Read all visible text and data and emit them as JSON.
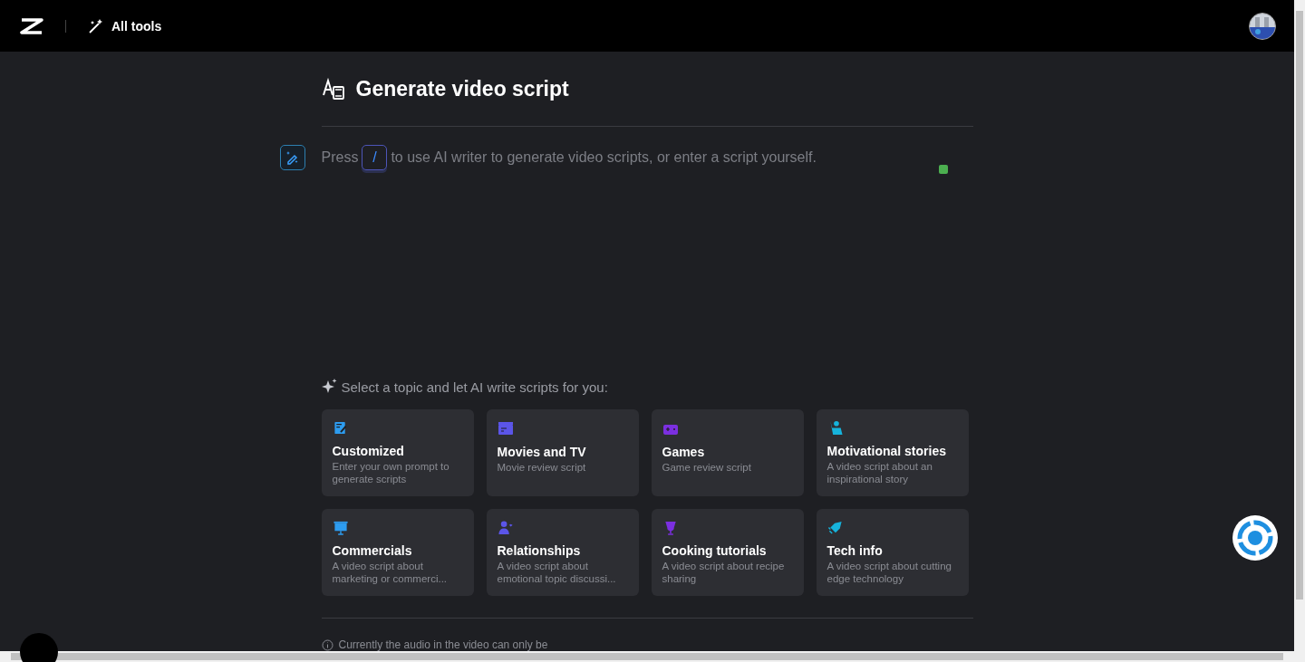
{
  "header": {
    "tools_label": "All tools"
  },
  "title": "Generate video script",
  "editor": {
    "placeholder_before": "Press",
    "key": "/",
    "placeholder_after": "to use AI writer to generate video scripts, or enter a script yourself."
  },
  "topics": {
    "heading": "Select a topic and let AI write scripts for you:",
    "items": [
      {
        "kind": "customized",
        "title": "Customized",
        "subtitle": "Enter your own prompt to generate scripts",
        "color": "#2d9cf0"
      },
      {
        "kind": "movies",
        "title": "Movies and TV",
        "subtitle": "Movie review script",
        "color": "#5b55e8"
      },
      {
        "kind": "games",
        "title": "Games",
        "subtitle": "Game review script",
        "color": "#7b2fe0"
      },
      {
        "kind": "motivational",
        "title": "Motivational stories",
        "subtitle": "A video script about an inspirational story",
        "color": "#16b3dc"
      },
      {
        "kind": "commercials",
        "title": "Commercials",
        "subtitle": "A video script about marketing or commerci...",
        "color": "#2d9cf0"
      },
      {
        "kind": "relationships",
        "title": "Relationships",
        "subtitle": "A video script about emotional topic discussi...",
        "color": "#5b55e8"
      },
      {
        "kind": "cooking",
        "title": "Cooking tutorials",
        "subtitle": "A video script about recipe sharing",
        "color": "#7b2fe0"
      },
      {
        "kind": "tech",
        "title": "Tech info",
        "subtitle": "A video script about cutting edge technology",
        "color": "#16b3dc"
      }
    ]
  },
  "footer_note": "Currently the audio in the video can only be"
}
